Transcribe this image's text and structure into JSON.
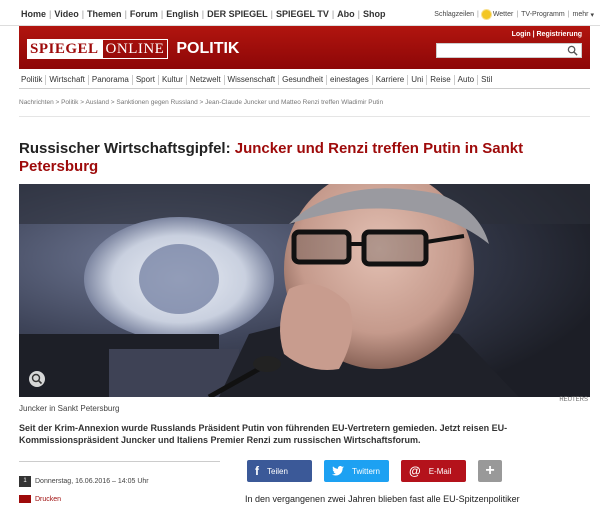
{
  "topnav": {
    "items": [
      "Home",
      "Video",
      "Themen",
      "Forum",
      "English",
      "DER SPIEGEL",
      "SPIEGEL TV",
      "Abo",
      "Shop"
    ],
    "right": {
      "headlines": "Schlagzeilen",
      "weather": "Wetter",
      "tv": "TV-Programm",
      "more": "mehr"
    }
  },
  "header": {
    "logo_spiegel": "SPIEGEL",
    "logo_online": "ONLINE",
    "section": "POLITIK",
    "login": "Login | Registrierung"
  },
  "secnav": [
    "Politik",
    "Wirtschaft",
    "Panorama",
    "Sport",
    "Kultur",
    "Netzwelt",
    "Wissenschaft",
    "Gesundheit",
    "einestages",
    "Karriere",
    "Uni",
    "Reise",
    "Auto",
    "Stil"
  ],
  "breadcrumb": "Nachrichten > Politik > Ausland > Sanktionen gegen Russland > Jean-Claude Juncker und Matteo Renzi treffen Wladimir Putin",
  "article": {
    "kicker": "Russischer Wirtschaftsgipfel:",
    "title": "Juncker und Renzi treffen Putin in Sankt Petersburg",
    "caption": "Juncker in Sankt Petersburg",
    "credit": "REUTERS",
    "lead": "Seit der Krim-Annexion wurde Russlands Präsident Putin von führenden EU-Vertretern gemieden. Jetzt reisen EU-Kommissionspräsident Juncker und Italiens Premier Renzi zum russischen Wirtschaftsforum.",
    "date": "Donnerstag, 16.06.2016 – 14:05 Uhr",
    "print": "Drucken",
    "body_start": "In den vergangenen zwei Jahren blieben fast alle EU-Spitzenpolitiker"
  },
  "share": {
    "facebook": "Teilen",
    "twitter": "Twittern",
    "email": "E-Mail",
    "more": "+"
  },
  "colors": {
    "brand_red": "#9e0a0a",
    "facebook": "#3b5998",
    "twitter": "#1da1f2",
    "email": "#b4121b"
  }
}
